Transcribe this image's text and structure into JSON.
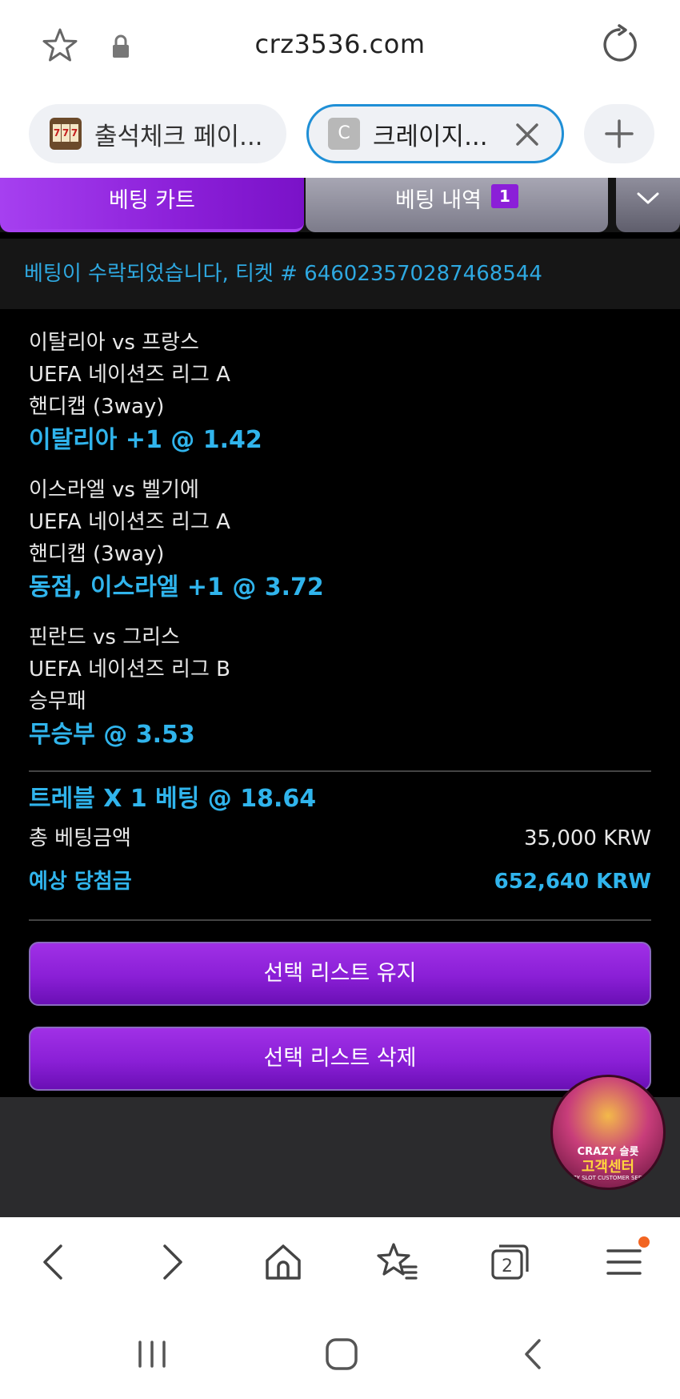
{
  "browser": {
    "url": "crz3536.com",
    "tabs": [
      {
        "label": "출석체크 페이..."
      },
      {
        "label": "크레이지...",
        "favicon_letter": "C"
      }
    ],
    "tab_count": "2"
  },
  "page": {
    "segments": {
      "cart_label": "베팅 카트",
      "history_label": "베팅 내역",
      "history_badge": "1"
    },
    "accepted_message": "베팅이 수락되었습니다, 티켓 # 646023570287468544",
    "bets": [
      {
        "match": "이탈리아 vs 프랑스",
        "league": "UEFA 네이션즈 리그 A",
        "market": "핸디캡 (3way)",
        "pick": "이탈리아 +1 @ 1.42"
      },
      {
        "match": "이스라엘 vs 벨기에",
        "league": "UEFA 네이션즈 리그 A",
        "market": "핸디캡 (3way)",
        "pick": "동점, 이스라엘 +1 @ 3.72"
      },
      {
        "match": "핀란드 vs 그리스",
        "league": "UEFA 네이션즈 리그 B",
        "market": "승무패",
        "pick": "무승부 @ 3.53"
      }
    ],
    "summary": {
      "bet_type": "트레블 X 1 베팅 @ 18.64",
      "stake_label": "총 베팅금액",
      "stake_value": "35,000 KRW",
      "payout_label": "예상 당첨금",
      "payout_value": "652,640 KRW"
    },
    "buttons": {
      "keep": "선택 리스트 유지",
      "delete": "선택 리스트 삭제"
    },
    "customer_service": {
      "brand": "CRAZY 슬롯",
      "label": "고객센터",
      "tagline": "CRAZY SLOT CUSTOMER SERVICE"
    }
  },
  "colors": {
    "accent_purple": "#8b1fd8",
    "accent_blue": "#30b4ec",
    "tab_border": "#1f8fd6",
    "menu_dot": "#f26522"
  }
}
